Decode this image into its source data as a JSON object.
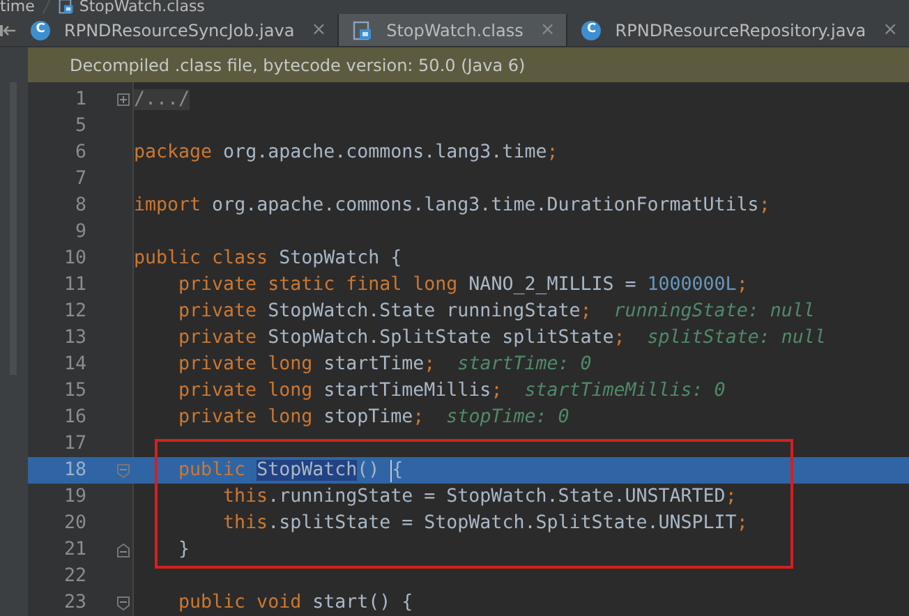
{
  "breadcrumb": [
    {
      "label": "time",
      "kind": "folder"
    },
    {
      "label": "StopWatch.class",
      "kind": "class"
    }
  ],
  "tabs": [
    {
      "label": "RPNDResourceSyncJob.java",
      "kind": "java",
      "badge": "C",
      "selected": false,
      "close": "×"
    },
    {
      "label": "StopWatch.class",
      "kind": "class",
      "selected": true,
      "close": "×"
    },
    {
      "label": "RPNDResourceRepository.java",
      "kind": "java",
      "badge": "C",
      "selected": false,
      "close": "×"
    }
  ],
  "banner": "Decompiled .class file, bytecode version: 50.0 (Java 6)",
  "lines": [
    {
      "number": "1",
      "kind": "collapsed",
      "current": false,
      "tokens": [
        {
          "kind": "folded",
          "text": "/.../"
        }
      ]
    },
    {
      "number": "5",
      "kind": "plain",
      "current": false
    },
    {
      "number": "6",
      "kind": "plain",
      "current": false,
      "tokens": [
        {
          "kind": "kw",
          "text": "package"
        },
        {
          "kind": "plain",
          "text": " org.apache.commons.lang3.time"
        },
        {
          "kind": "kw",
          "text": ";"
        }
      ]
    },
    {
      "number": "7",
      "kind": "plain",
      "current": false
    },
    {
      "number": "8",
      "kind": "plain",
      "current": false,
      "tokens": [
        {
          "kind": "kw",
          "text": "import"
        },
        {
          "kind": "plain",
          "text": " org.apache.commons.lang3.time.DurationFormatUtils"
        },
        {
          "kind": "kw",
          "text": ";"
        }
      ]
    },
    {
      "number": "9",
      "kind": "plain",
      "current": false
    },
    {
      "number": "10",
      "kind": "plain",
      "current": false,
      "tokens": [
        {
          "kind": "kw",
          "text": "public class"
        },
        {
          "kind": "plain",
          "text": " StopWatch {"
        }
      ]
    },
    {
      "number": "11",
      "kind": "plain",
      "current": false,
      "tokens": [
        {
          "kind": "kw",
          "text": "    private static final long"
        },
        {
          "kind": "plain",
          "text": " NANO_2_MILLIS = "
        },
        {
          "kind": "num",
          "text": "1000000L"
        },
        {
          "kind": "kw",
          "text": ";"
        }
      ]
    },
    {
      "number": "12",
      "kind": "plain",
      "current": false,
      "tokens": [
        {
          "kind": "kw",
          "text": "    private"
        },
        {
          "kind": "plain",
          "text": " StopWatch.State runningState"
        },
        {
          "kind": "kw",
          "text": ";"
        },
        {
          "kind": "hint",
          "text": "  runningState: null"
        }
      ]
    },
    {
      "number": "13",
      "kind": "plain",
      "current": false,
      "tokens": [
        {
          "kind": "kw",
          "text": "    private"
        },
        {
          "kind": "plain",
          "text": " StopWatch.SplitState splitState"
        },
        {
          "kind": "kw",
          "text": ";"
        },
        {
          "kind": "hint",
          "text": "  splitState: null"
        }
      ]
    },
    {
      "number": "14",
      "kind": "plain",
      "current": false,
      "tokens": [
        {
          "kind": "kw",
          "text": "    private long"
        },
        {
          "kind": "plain",
          "text": " startTime"
        },
        {
          "kind": "kw",
          "text": ";"
        },
        {
          "kind": "hint",
          "text": "  startTime: 0"
        }
      ]
    },
    {
      "number": "15",
      "kind": "plain",
      "current": false,
      "tokens": [
        {
          "kind": "kw",
          "text": "    private long"
        },
        {
          "kind": "plain",
          "text": " startTimeMillis"
        },
        {
          "kind": "kw",
          "text": ";"
        },
        {
          "kind": "hint",
          "text": "  startTimeMillis: 0"
        }
      ]
    },
    {
      "number": "16",
      "kind": "plain",
      "current": false,
      "tokens": [
        {
          "kind": "kw",
          "text": "    private long"
        },
        {
          "kind": "plain",
          "text": " stopTime"
        },
        {
          "kind": "kw",
          "text": ";"
        },
        {
          "kind": "hint",
          "text": "  stopTime: 0"
        }
      ]
    },
    {
      "number": "17",
      "kind": "plain",
      "current": false
    },
    {
      "number": "18",
      "kind": "fold_start",
      "current": true,
      "tokens": [
        {
          "kind": "kw",
          "text": "    public "
        },
        {
          "kind": "selected",
          "text": "StopWatch"
        },
        {
          "kind": "plain",
          "text": "() "
        },
        {
          "kind": "caret"
        },
        {
          "kind": "plain",
          "text": "{"
        }
      ]
    },
    {
      "number": "19",
      "kind": "plain",
      "current": false,
      "tokens": [
        {
          "kind": "kw",
          "text": "        this"
        },
        {
          "kind": "plain",
          "text": ".runningState = StopWatch.State.UNSTARTED"
        },
        {
          "kind": "kw",
          "text": ";"
        }
      ]
    },
    {
      "number": "20",
      "kind": "plain",
      "current": false,
      "tokens": [
        {
          "kind": "kw",
          "text": "        this"
        },
        {
          "kind": "plain",
          "text": ".splitState = StopWatch.SplitState.UNSPLIT"
        },
        {
          "kind": "kw",
          "text": ";"
        }
      ]
    },
    {
      "number": "21",
      "kind": "fold_end",
      "current": false,
      "tokens": [
        {
          "kind": "plain",
          "text": "    }"
        }
      ]
    },
    {
      "number": "22",
      "kind": "plain",
      "current": false
    },
    {
      "number": "23",
      "kind": "fold_start",
      "current": false,
      "tokens": [
        {
          "kind": "kw",
          "text": "    public void"
        },
        {
          "kind": "plain",
          "text": " start() {"
        }
      ]
    }
  ]
}
